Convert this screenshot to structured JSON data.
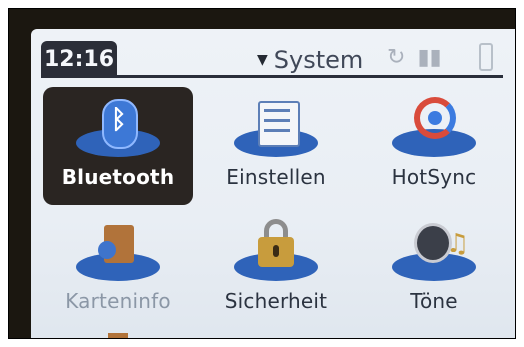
{
  "titlebar": {
    "time": "12:16",
    "menu_label": "System"
  },
  "apps": [
    {
      "label": "Bluetooth",
      "selected": true
    },
    {
      "label": "Einstellen"
    },
    {
      "label": "HotSync"
    },
    {
      "label": "Karteninfo",
      "dim": true
    },
    {
      "label": "Sicherheit"
    },
    {
      "label": "Töne"
    }
  ],
  "icons": {
    "menu_arrow": "triangle-down-icon",
    "sync_status": "sync-icon",
    "signal": "signal-bars-icon",
    "battery": "battery-icon"
  },
  "colors": {
    "accent_blue": "#2f63b9",
    "selected_bg": "#2a2522"
  }
}
